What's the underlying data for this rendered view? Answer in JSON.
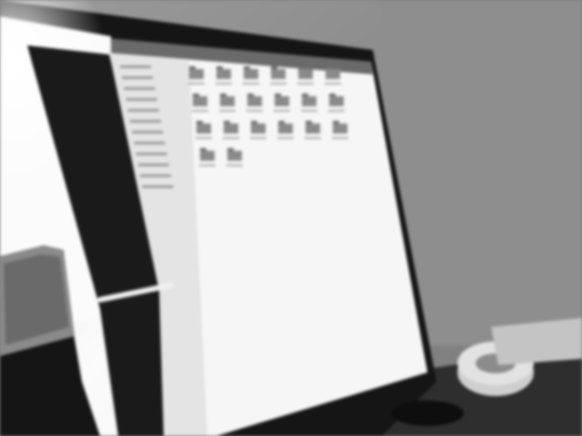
{
  "photo": {
    "subject": "computer-monitor-file-manager",
    "tone": "grayscale",
    "colors": {
      "wall": "#8a8a8a",
      "monitor_bezel": "#141414",
      "screen": "#f4f4f4",
      "sidebar": "#e8e8e8",
      "titlebar": "#707070",
      "desk": "#2a2a2a",
      "tape": "#d8d8d8"
    }
  },
  "file_manager": {
    "folder_icon": "folder-icon",
    "sidebar_item_count": 12,
    "folder_rows": [
      6,
      6,
      6,
      2
    ]
  }
}
